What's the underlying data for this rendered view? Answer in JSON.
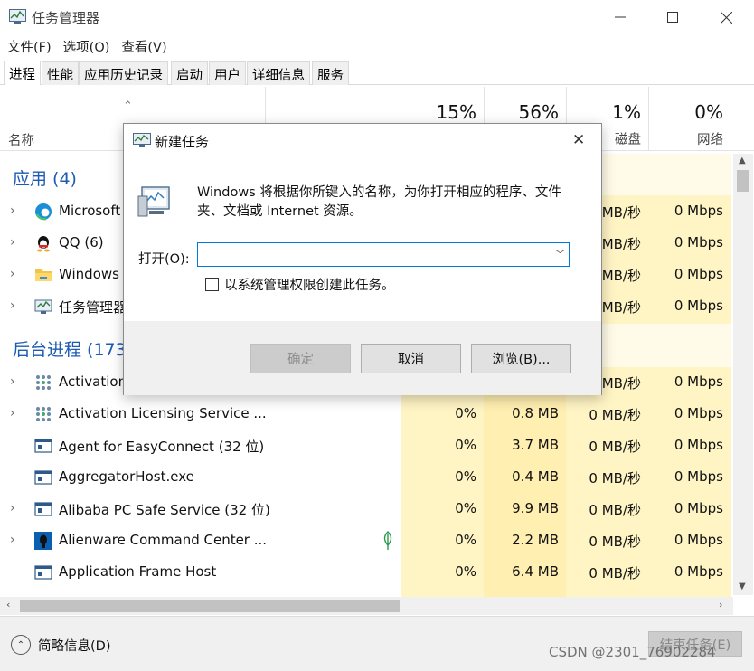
{
  "window": {
    "title": "任务管理器",
    "min_icon": "minimize-icon",
    "max_icon": "maximize-icon",
    "close_icon": "close-icon"
  },
  "menu": [
    "文件(F)",
    "选项(O)",
    "查看(V)"
  ],
  "tabs": [
    "进程",
    "性能",
    "应用历史记录",
    "启动",
    "用户",
    "详细信息",
    "服务"
  ],
  "columns": {
    "name": "名称",
    "cpu": {
      "percent": "15%",
      "label": ""
    },
    "memory": {
      "percent": "56%",
      "label": ""
    },
    "disk": {
      "percent": "1%",
      "label": "磁盘"
    },
    "network": {
      "percent": "0%",
      "label": "网络"
    }
  },
  "sections": {
    "apps": "应用 (4)",
    "background": "后台进程 (173"
  },
  "apps": [
    {
      "name": "Microsoft",
      "icon": "edge-icon",
      "disk": "MB/秒",
      "net": "0 Mbps"
    },
    {
      "name": "QQ (6)",
      "icon": "qq-penguin-icon",
      "disk": "MB/秒",
      "net": "0 Mbps"
    },
    {
      "name": "Windows",
      "icon": "folder-icon",
      "disk": "MB/秒",
      "net": "0 Mbps"
    },
    {
      "name": "任务管理器",
      "icon": "task-manager-icon",
      "disk": "MB/秒",
      "net": "0 Mbps"
    }
  ],
  "background": [
    {
      "name": "Activation",
      "icon": "dots-grid-icon",
      "cpu": "",
      "mem": "",
      "disk": "MB/秒",
      "net": "0 Mbps",
      "expand": true
    },
    {
      "name": "Activation Licensing Service ...",
      "icon": "dots-grid-icon",
      "cpu": "0%",
      "mem": "0.8 MB",
      "disk": "0 MB/秒",
      "net": "0 Mbps",
      "expand": true
    },
    {
      "name": "Agent for EasyConnect (32 位)",
      "icon": "window-app-icon",
      "cpu": "0%",
      "mem": "3.7 MB",
      "disk": "0 MB/秒",
      "net": "0 Mbps",
      "expand": false
    },
    {
      "name": "AggregatorHost.exe",
      "icon": "window-app-icon",
      "cpu": "0%",
      "mem": "0.4 MB",
      "disk": "0 MB/秒",
      "net": "0 Mbps",
      "expand": false
    },
    {
      "name": "Alibaba PC Safe Service (32 位)",
      "icon": "window-app-icon",
      "cpu": "0%",
      "mem": "9.9 MB",
      "disk": "0 MB/秒",
      "net": "0 Mbps",
      "expand": true
    },
    {
      "name": "Alienware Command Center ...",
      "icon": "alienware-icon",
      "cpu": "0%",
      "mem": "2.2 MB",
      "disk": "0 MB/秒",
      "net": "0 Mbps",
      "expand": true,
      "leaf": true
    },
    {
      "name": "Application Frame Host",
      "icon": "window-app-icon",
      "cpu": "0%",
      "mem": "6.4 MB",
      "disk": "0 MB/秒",
      "net": "0 Mbps",
      "expand": false
    }
  ],
  "footer": {
    "fewer_details": "简略信息(D)",
    "end_task": "结束任务(E)",
    "watermark": "CSDN @2301_76902284"
  },
  "dialog": {
    "title": "新建任务",
    "description": "Windows 将根据你所键入的名称，为你打开相应的程序、文件夹、文档或 Internet 资源。",
    "open_label": "打开(O):",
    "open_value": "",
    "admin_checkbox": "以系统管理权限创建此任务。",
    "ok": "确定",
    "cancel": "取消",
    "browse": "浏览(B)..."
  }
}
